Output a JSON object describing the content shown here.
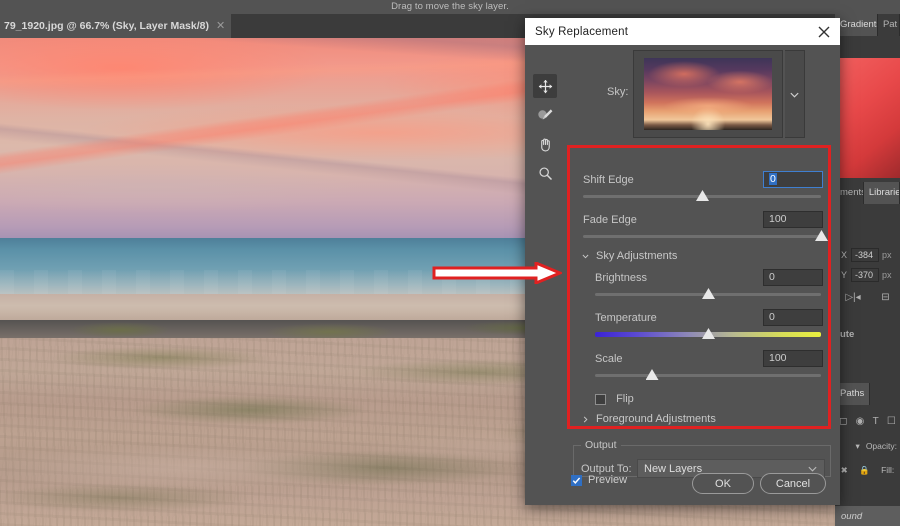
{
  "app": {
    "status_hint": "Drag to move the sky layer.",
    "document_tab": {
      "label": "79_1920.jpg @ 66.7% (Sky, Layer Mask/8)",
      "close_icon": "close-icon"
    }
  },
  "right_panels": {
    "tabs_top": [
      "Gradients",
      "Pat"
    ],
    "tabs_mid": [
      "ments",
      "Libraries"
    ],
    "tabs_paths": [
      "ute",
      "Paths"
    ],
    "properties": {
      "x_label": "X",
      "x_value": "-384",
      "x_unit": "px",
      "y_label": "Y",
      "y_value": "-370",
      "y_unit": "px"
    },
    "layers": {
      "opacity_label": "Opacity:",
      "fill_label": "Fill:",
      "background_layer": "ound"
    }
  },
  "dialog": {
    "title": "Sky Replacement",
    "close_icon": "close-icon",
    "tools": [
      {
        "name": "move-tool",
        "icon": "move-icon",
        "selected": true
      },
      {
        "name": "sky-brush-tool",
        "icon": "brush-icon",
        "selected": false
      },
      {
        "name": "hand-tool",
        "icon": "hand-icon",
        "selected": false
      },
      {
        "name": "zoom-tool",
        "icon": "magnifier-icon",
        "selected": false
      }
    ],
    "sky_picker": {
      "label": "Sky:",
      "chevron_icon": "chevron-down-icon"
    },
    "controls": [
      {
        "label": "Shift Edge",
        "value": "0",
        "slider_pct": 50,
        "focused": true
      },
      {
        "label": "Fade Edge",
        "value": "100",
        "slider_pct": 100,
        "focused": false
      }
    ],
    "sky_adjustments": {
      "title": "Sky Adjustments",
      "expanded": true,
      "chevron_icon": "chevron-down-icon",
      "controls": [
        {
          "label": "Brightness",
          "value": "0",
          "slider_pct": 50,
          "gradient": false
        },
        {
          "label": "Temperature",
          "value": "0",
          "slider_pct": 50,
          "gradient": true
        },
        {
          "label": "Scale",
          "value": "100",
          "slider_pct": 25,
          "gradient": false
        }
      ],
      "flip": {
        "label": "Flip",
        "checked": false
      }
    },
    "foreground_adjustments": {
      "title": "Foreground Adjustments",
      "expanded": false,
      "chevron_icon": "chevron-right-icon"
    },
    "output": {
      "group_label": "Output",
      "output_to_label": "Output To:",
      "output_to_value": "New Layers",
      "chevron_icon": "chevron-down-icon"
    },
    "footer": {
      "preview_label": "Preview",
      "preview_checked": true,
      "ok_label": "OK",
      "cancel_label": "Cancel"
    }
  },
  "annotation": {
    "highlight_color": "#e02121",
    "arrow_icon": "arrow-right-icon"
  }
}
